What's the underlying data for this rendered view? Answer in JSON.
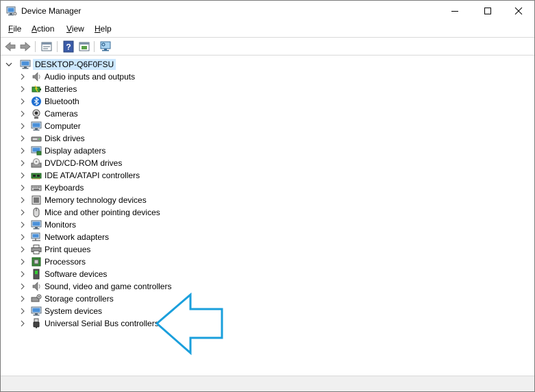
{
  "window": {
    "title": "Device Manager",
    "icon": "device-manager-icon",
    "controls": [
      "minimize-icon",
      "maximize-icon",
      "close-icon"
    ]
  },
  "menu": {
    "file": {
      "underline": "F",
      "rest": "ile"
    },
    "action": {
      "underline": "A",
      "rest": "ction"
    },
    "view": {
      "underline": "V",
      "rest": "iew"
    },
    "help": {
      "underline": "H",
      "rest": "elp"
    }
  },
  "toolbar": {
    "buttons": [
      "back-arrow-icon",
      "forward-arrow-icon",
      "properties-icon",
      "help-icon",
      "update-driver-icon",
      "scan-hardware-icon"
    ]
  },
  "tree": {
    "root": "DESKTOP-Q6F0FSU",
    "categories": [
      {
        "label": "Audio inputs and outputs",
        "icon": "speaker-icon"
      },
      {
        "label": "Batteries",
        "icon": "battery-icon"
      },
      {
        "label": "Bluetooth",
        "icon": "bluetooth-icon"
      },
      {
        "label": "Cameras",
        "icon": "camera-icon"
      },
      {
        "label": "Computer",
        "icon": "computer-icon"
      },
      {
        "label": "Disk drives",
        "icon": "disk-drive-icon"
      },
      {
        "label": "Display adapters",
        "icon": "display-adapter-icon"
      },
      {
        "label": "DVD/CD-ROM drives",
        "icon": "dvd-drive-icon"
      },
      {
        "label": "IDE ATA/ATAPI controllers",
        "icon": "ide-controller-icon"
      },
      {
        "label": "Keyboards",
        "icon": "keyboard-icon"
      },
      {
        "label": "Memory technology devices",
        "icon": "memory-icon"
      },
      {
        "label": "Mice and other pointing devices",
        "icon": "mouse-icon"
      },
      {
        "label": "Monitors",
        "icon": "monitor-icon"
      },
      {
        "label": "Network adapters",
        "icon": "network-adapter-icon"
      },
      {
        "label": "Print queues",
        "icon": "printer-icon"
      },
      {
        "label": "Processors",
        "icon": "processor-icon"
      },
      {
        "label": "Software devices",
        "icon": "software-device-icon"
      },
      {
        "label": "Sound, video and game controllers",
        "icon": "sound-controller-icon"
      },
      {
        "label": "Storage controllers",
        "icon": "storage-controller-icon"
      },
      {
        "label": "System devices",
        "icon": "system-device-icon"
      },
      {
        "label": "Universal Serial Bus controllers",
        "icon": "usb-icon"
      }
    ]
  },
  "annotation": {
    "icon": "pointer-arrow-icon",
    "color": "#1a9fdc"
  }
}
